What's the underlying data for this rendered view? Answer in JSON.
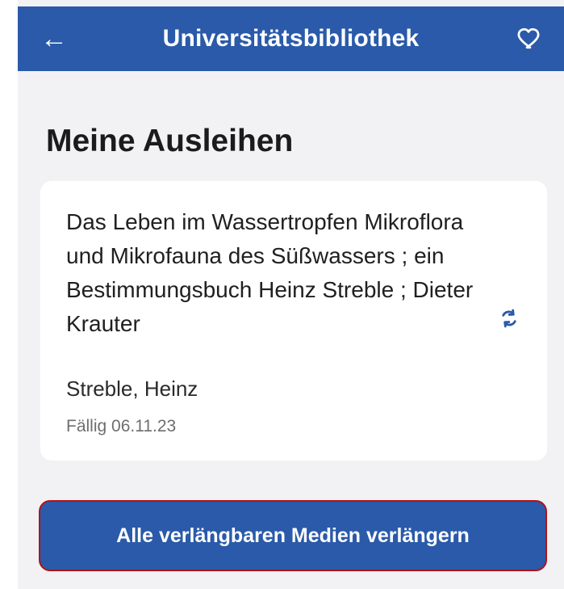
{
  "header": {
    "title": "Universitätsbibliothek",
    "back_icon": "arrow-left-icon",
    "favorite_icon": "heart-outline-icon"
  },
  "page": {
    "title": "Meine Ausleihen"
  },
  "loan": {
    "title": "Das Leben im Wassertropfen Mikroflora und Mikrofauna des Süßwassers ; ein Bestimmungsbuch Heinz Streble ; Dieter Krauter",
    "author": "Streble, Heinz",
    "due": "Fällig 06.11.23",
    "renew_icon": "renew-icon"
  },
  "actions": {
    "renew_all_label": "Alle verlängbaren Medien verlängern"
  },
  "colors": {
    "primary": "#2a5aa9",
    "background": "#f2f2f4",
    "highlight_border": "#b1121a"
  }
}
